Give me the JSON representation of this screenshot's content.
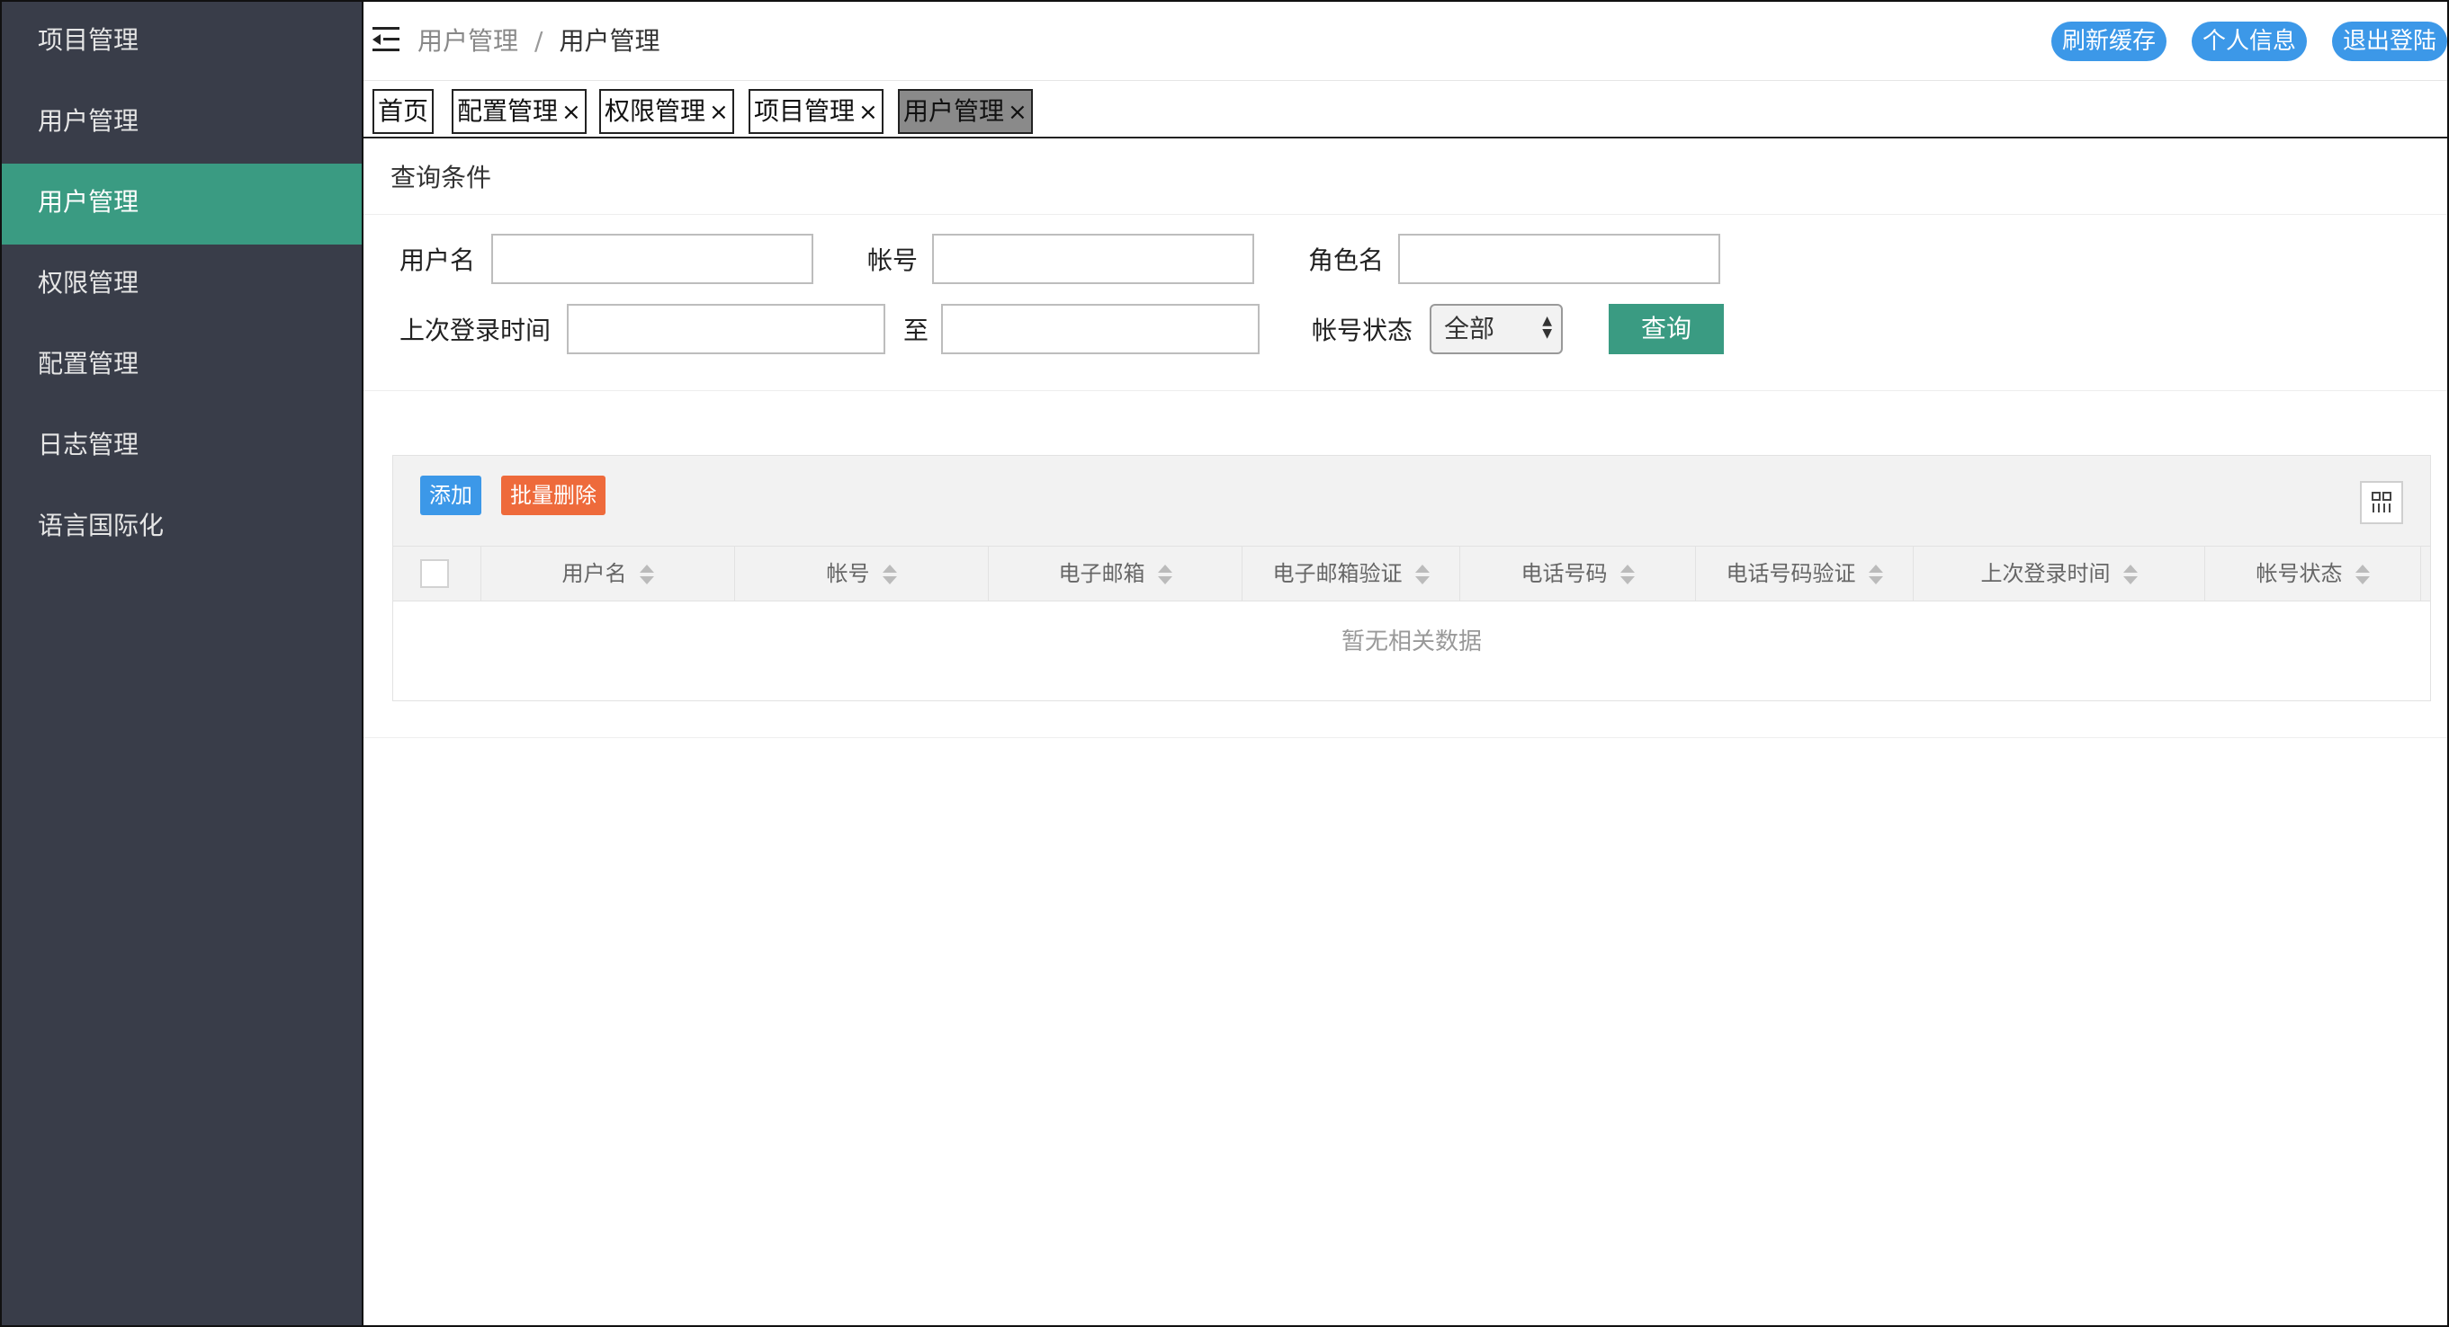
{
  "sidebar": {
    "items": [
      {
        "label": "项目管理",
        "active": false
      },
      {
        "label": "用户管理",
        "active": false
      },
      {
        "label": "用户管理",
        "active": true
      },
      {
        "label": "权限管理",
        "active": false
      },
      {
        "label": "配置管理",
        "active": false
      },
      {
        "label": "日志管理",
        "active": false
      },
      {
        "label": "语言国际化",
        "active": false
      }
    ],
    "active_color": "#3a9b82",
    "background": "#393d49"
  },
  "header": {
    "breadcrumb": [
      "用户管理",
      "用户管理"
    ],
    "separator": "/",
    "actions": {
      "refresh_cache": "刷新缓存",
      "profile": "个人信息",
      "logout": "退出登陆"
    },
    "menu_icon": "indent-menu-icon"
  },
  "tabs": [
    {
      "label": "首页",
      "closable": false,
      "active": false
    },
    {
      "label": "配置管理",
      "closable": true,
      "active": false
    },
    {
      "label": "权限管理",
      "closable": true,
      "active": false
    },
    {
      "label": "项目管理",
      "closable": true,
      "active": false
    },
    {
      "label": "用户管理",
      "closable": true,
      "active": true
    }
  ],
  "tab_close_glyph": "×",
  "query": {
    "title": "查询条件",
    "username_label": "用户名",
    "username_value": "",
    "account_label": "帐号",
    "account_value": "",
    "role_label": "角色名",
    "role_value": "",
    "last_login_label": "上次登录时间",
    "last_login_from": "",
    "to_label": "至",
    "last_login_to": "",
    "status_label": "帐号状态",
    "status_selected": "全部",
    "submit_label": "查询"
  },
  "table": {
    "toolbar": {
      "add_label": "添加",
      "batch_delete_label": "批量删除",
      "columns_icon": "columns-grid-icon"
    },
    "columns": [
      "用户名",
      "帐号",
      "电子邮箱",
      "电子邮箱验证",
      "电话号码",
      "电话号码验证",
      "上次登录时间",
      "帐号状态"
    ],
    "rows": [],
    "empty_text": "暂无相关数据"
  },
  "colors": {
    "primary_blue": "#3c98e8",
    "danger_orange": "#ee6a3b",
    "teal": "#3a9b82"
  }
}
